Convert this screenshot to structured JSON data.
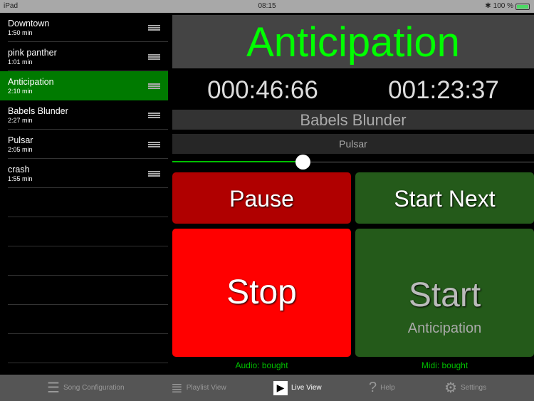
{
  "status": {
    "device": "iPad",
    "time": "08:15",
    "battery": "100 %"
  },
  "playlist": [
    {
      "title": "Downtown",
      "duration": "1:50 min"
    },
    {
      "title": "pink panther",
      "duration": "1:01 min"
    },
    {
      "title": "Anticipation",
      "duration": "2:10 min",
      "selected": true
    },
    {
      "title": "Babels Blunder",
      "duration": "2:27 min"
    },
    {
      "title": "Pulsar",
      "duration": "2:05 min"
    },
    {
      "title": "crash",
      "duration": "1:55 min"
    }
  ],
  "live": {
    "current": "Anticipation",
    "elapsed": "000:46:66",
    "total": "001:23:37",
    "next": "Babels Blunder",
    "after_next": "Pulsar",
    "progress": 0.36,
    "pause": "Pause",
    "start_next": "Start Next",
    "stop": "Stop",
    "start": "Start",
    "start_song": "Anticipation",
    "audio_license": "Audio: bought",
    "midi_license": "Midi: bought"
  },
  "tabs": [
    {
      "label": "Song Configuration",
      "icon": "sliders-icon"
    },
    {
      "label": "Playlist View",
      "icon": "list-icon"
    },
    {
      "label": "Live View",
      "icon": "play-icon",
      "active": true
    },
    {
      "label": "Help",
      "icon": "question-icon"
    },
    {
      "label": "Settings",
      "icon": "gear-icon"
    }
  ],
  "colors": {
    "accent": "#00ff00",
    "selected": "#007a00",
    "stop": "#ff0000",
    "pause": "#b00000",
    "start": "#245a1a"
  }
}
